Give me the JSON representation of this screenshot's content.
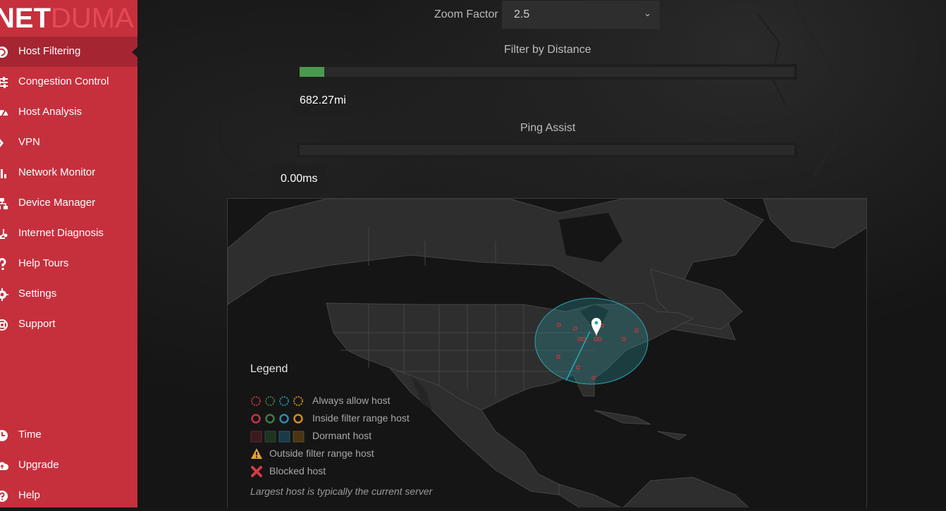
{
  "brand": {
    "net": "NET",
    "duma": "DUMA"
  },
  "sidebar": {
    "items": [
      {
        "label": "Host Filtering",
        "icon": "globe-icon",
        "active": true
      },
      {
        "label": "Congestion Control",
        "icon": "sliders-icon"
      },
      {
        "label": "Host Analysis",
        "icon": "gauge-icon"
      },
      {
        "label": "VPN",
        "icon": "vpn-key-icon"
      },
      {
        "label": "Network Monitor",
        "icon": "bar-chart-icon"
      },
      {
        "label": "Device Manager",
        "icon": "network-icon"
      },
      {
        "label": "Internet Diagnosis",
        "icon": "stethoscope-icon"
      },
      {
        "label": "Help Tours",
        "icon": "question-icon"
      },
      {
        "label": "Settings",
        "icon": "gear-icon"
      },
      {
        "label": "Support",
        "icon": "lifebuoy-icon"
      }
    ],
    "bottom": [
      {
        "label": "Time",
        "icon": "clock-icon"
      },
      {
        "label": "Upgrade",
        "icon": "cloud-upgrade-icon"
      },
      {
        "label": "Help",
        "icon": "help-circle-icon"
      }
    ]
  },
  "controls": {
    "zoom_label": "Zoom Factor",
    "zoom_value": "2.5",
    "distance_label": "Filter by Distance",
    "distance_value": "682.27mi",
    "distance_fill_fraction": 0.05,
    "ping_label": "Ping Assist",
    "ping_value": "0.00ms",
    "ping_fill_fraction": 0.0
  },
  "legend": {
    "title": "Legend",
    "rows": [
      "Always allow host",
      "Inside filter range host",
      "Dormant host",
      "Outside filter range host",
      "Blocked host"
    ],
    "note": "Largest host is typically the current server"
  },
  "colors": {
    "sidebar": "#c6303d",
    "sidebar_active": "#a52632",
    "accent_green": "#4a9a4e",
    "range_circle": "#2aa7b0",
    "legend_red": "#c0353f",
    "legend_green": "#3f7a45",
    "legend_blue": "#2e8ca8",
    "legend_orange": "#d38a23"
  }
}
